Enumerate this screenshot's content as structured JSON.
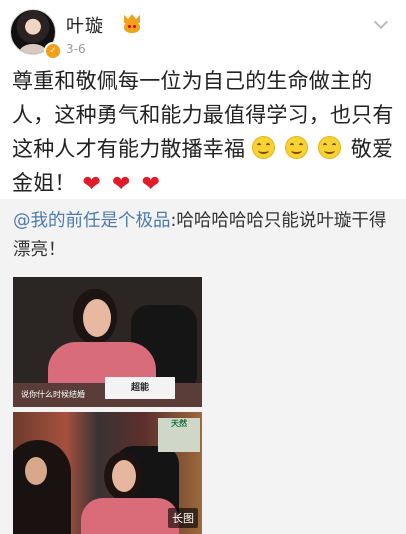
{
  "post": {
    "author_name": "叶璇",
    "timestamp": "3-6",
    "content": {
      "text": "尊重和敬佩每一位为自己的生命做主的人，这种勇气和能力最值得学习，也只有这种人才有能力散播幸福",
      "emojis": [
        "smile-emoji",
        "smile-emoji",
        "smile-emoji"
      ],
      "after_emoji": "敬爱金姐！",
      "hearts": [
        "❤",
        "❤",
        "❤"
      ]
    }
  },
  "repost": {
    "mention": "@我的前任是个极品",
    "text": ":哈哈哈哈哈只能说叶璇干得漂亮！"
  },
  "images": {
    "top_caption": "说你什么时候结婚",
    "top_sign": "超能",
    "bottom_sign": "天然",
    "long_image_label": "长图"
  }
}
